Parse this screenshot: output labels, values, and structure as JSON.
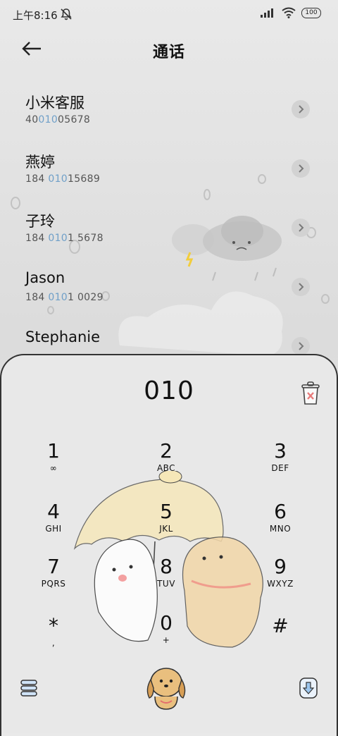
{
  "status": {
    "time": "上午8:16",
    "battery": "100"
  },
  "header": {
    "title": "通话"
  },
  "results": [
    {
      "name": "小米客服",
      "num_pre": "40",
      "num_hl": "010",
      "num_post": "05678"
    },
    {
      "name": "燕婷",
      "num_pre": "184 ",
      "num_hl": "010",
      "num_post": "15689"
    },
    {
      "name": "子玲",
      "num_pre": "184 ",
      "num_hl": "010",
      "num_post": "1 5678"
    },
    {
      "name": "Jason",
      "num_pre": "184 ",
      "num_hl": "010",
      "num_post": "1 0029"
    },
    {
      "name": "Stephanie",
      "num_pre": "",
      "num_hl": "",
      "num_post": ""
    }
  ],
  "dialpad": {
    "input": "010",
    "keys": [
      {
        "d": "1",
        "l": "∞"
      },
      {
        "d": "2",
        "l": "ABC"
      },
      {
        "d": "3",
        "l": "DEF"
      },
      {
        "d": "4",
        "l": "GHI"
      },
      {
        "d": "5",
        "l": "JKL"
      },
      {
        "d": "6",
        "l": "MNO"
      },
      {
        "d": "7",
        "l": "PQRS"
      },
      {
        "d": "8",
        "l": "TUV"
      },
      {
        "d": "9",
        "l": "WXYZ"
      },
      {
        "d": "*",
        "l": ","
      },
      {
        "d": "0",
        "l": "+"
      },
      {
        "d": "#",
        "l": ""
      }
    ]
  },
  "icons": {
    "mute": "bell-off-icon",
    "back": "arrow-left-icon",
    "arrow": "chevron-right-icon",
    "trash": "delete-icon",
    "menu": "stack-icon",
    "call": "dog-call-icon",
    "download": "download-icon"
  },
  "colors": {
    "highlight": "#6f9fc8",
    "accent_dog": "#e9bf7e"
  }
}
